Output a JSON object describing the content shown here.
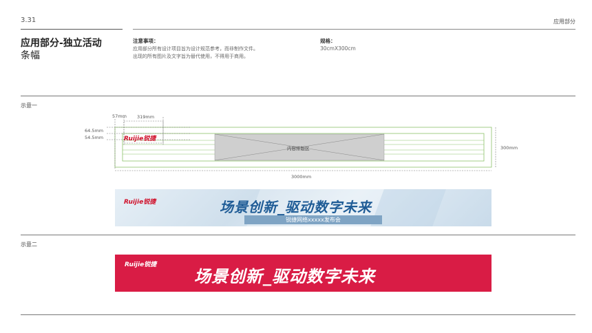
{
  "header": {
    "page_number": "3.31",
    "section": "应用部分"
  },
  "title": {
    "line1": "应用部分-独立活动",
    "line2": "条幅"
  },
  "notes": {
    "heading": "注意事项：",
    "lines": [
      "应用部分所有设计项目旨为设计规范参考，而非制作文件。",
      "出现的所有图片及文字旨为替代使用，不得用于商用。"
    ]
  },
  "spec": {
    "heading": "规格：",
    "value": "30cmX300cm"
  },
  "example1": {
    "label": "示意一",
    "diagram": {
      "dim_57": "57mm",
      "dim_319": "319mm",
      "dim_64_5": "64.5mm",
      "dim_54_5": "54.5mm",
      "dim_300": "300mm",
      "dim_3000": "3000mm",
      "content_area": "内容排版区",
      "logo": "Ruijie锐捷"
    },
    "banner": {
      "logo": "Ruijie锐捷",
      "slogan": "场景创新_驱动数字未来",
      "event": "锐捷网络xxxxx发布会"
    }
  },
  "example2": {
    "label": "示意二",
    "banner": {
      "logo": "Ruijie锐捷",
      "slogan": "场景创新_驱动数字未来"
    }
  },
  "colors": {
    "guide_green": "#8cc26a",
    "banner_red": "#d91c45",
    "brand_red": "#d0112b",
    "slogan_blue": "#1f5c96"
  }
}
